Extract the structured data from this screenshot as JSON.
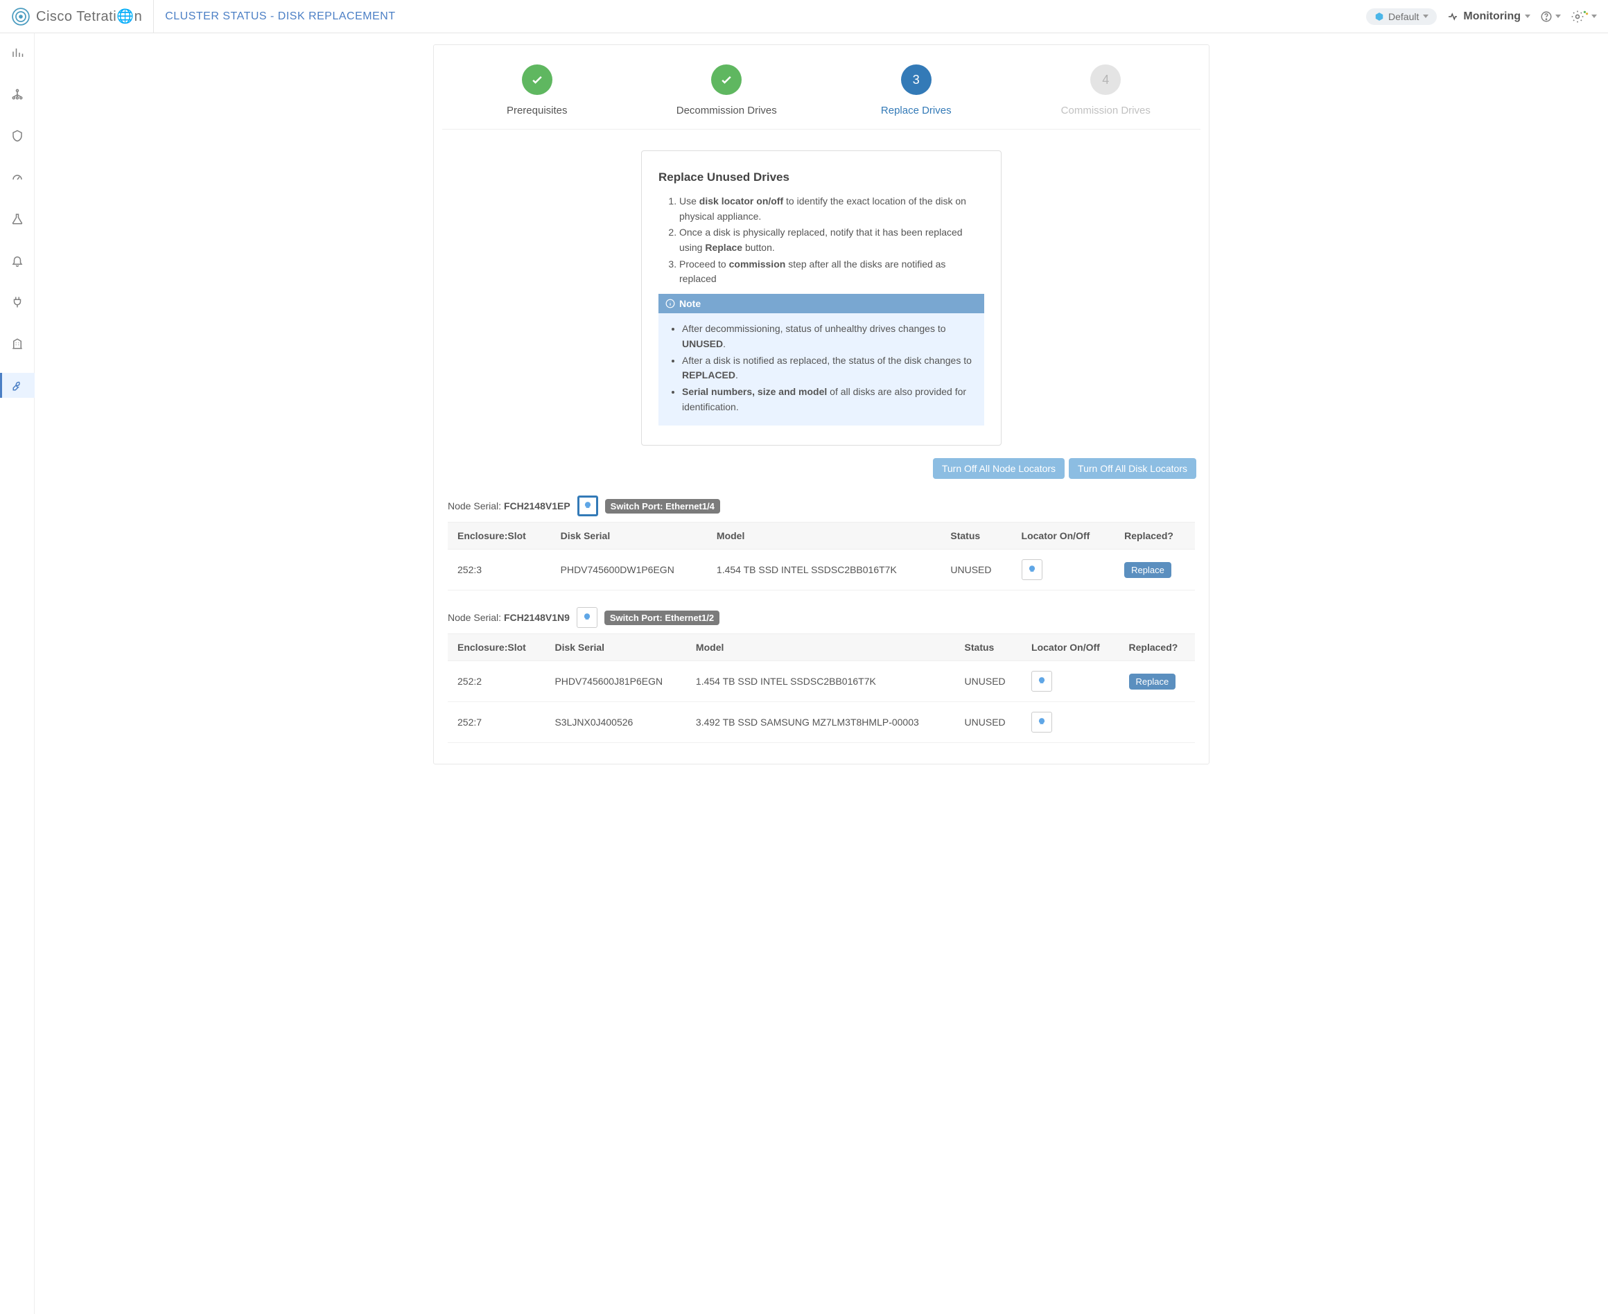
{
  "header": {
    "brand": "Cisco Tetrati🌐n",
    "pageTitle": "CLUSTER STATUS - DISK REPLACEMENT",
    "scope": "Default",
    "monitoring": "Monitoring"
  },
  "stepper": {
    "steps": [
      {
        "label": "Prerequisites",
        "state": "done"
      },
      {
        "label": "Decommission Drives",
        "state": "done"
      },
      {
        "label": "Replace Drives",
        "state": "current",
        "num": "3"
      },
      {
        "label": "Commission Drives",
        "state": "pending",
        "num": "4"
      }
    ]
  },
  "card": {
    "title": "Replace Unused Drives",
    "ol": {
      "i1_a": "Use ",
      "i1_b": "disk locator on/off",
      "i1_c": " to identify the exact location of the disk on physical appliance.",
      "i2_a": "Once a disk is physically replaced, notify that it has been replaced using ",
      "i2_b": "Replace",
      "i2_c": " button.",
      "i3_a": "Proceed to ",
      "i3_b": "commission",
      "i3_c": " step after all the disks are notified as replaced"
    },
    "note": {
      "label": "Note",
      "n1_a": "After decommissioning, status of unhealthy drives changes to ",
      "n1_b": "UNUSED",
      "n1_c": ".",
      "n2_a": "After a disk is notified as replaced, the status of the disk changes to ",
      "n2_b": "REPLACED",
      "n2_c": ".",
      "n3_a": "Serial numbers, size and model",
      "n3_b": " of all disks are also provided for identification."
    }
  },
  "buttons": {
    "turnOffNodes": "Turn Off All Node Locators",
    "turnOffDisks": "Turn Off All Disk Locators",
    "replace": "Replace"
  },
  "tableHeaders": {
    "enclosure": "Enclosure:Slot",
    "diskSerial": "Disk Serial",
    "model": "Model",
    "status": "Status",
    "locator": "Locator On/Off",
    "replaced": "Replaced?"
  },
  "nodes": [
    {
      "serialLabel": "Node Serial: ",
      "serial": "FCH2148V1EP",
      "switchPortLabel": "Switch Port: Ethernet1/4",
      "locatorActive": true,
      "disks": [
        {
          "slot": "252:3",
          "serial": "PHDV745600DW1P6EGN",
          "model": "1.454 TB SSD INTEL SSDSC2BB016T7K",
          "status": "UNUSED",
          "showReplace": true
        }
      ]
    },
    {
      "serialLabel": "Node Serial: ",
      "serial": "FCH2148V1N9",
      "switchPortLabel": "Switch Port: Ethernet1/2",
      "locatorActive": false,
      "disks": [
        {
          "slot": "252:2",
          "serial": "PHDV745600J81P6EGN",
          "model": "1.454 TB SSD INTEL SSDSC2BB016T7K",
          "status": "UNUSED",
          "showReplace": true
        },
        {
          "slot": "252:7",
          "serial": "S3LJNX0J400526",
          "model": "3.492 TB SSD SAMSUNG MZ7LM3T8HMLP-00003",
          "status": "UNUSED",
          "showReplace": false
        }
      ]
    }
  ]
}
